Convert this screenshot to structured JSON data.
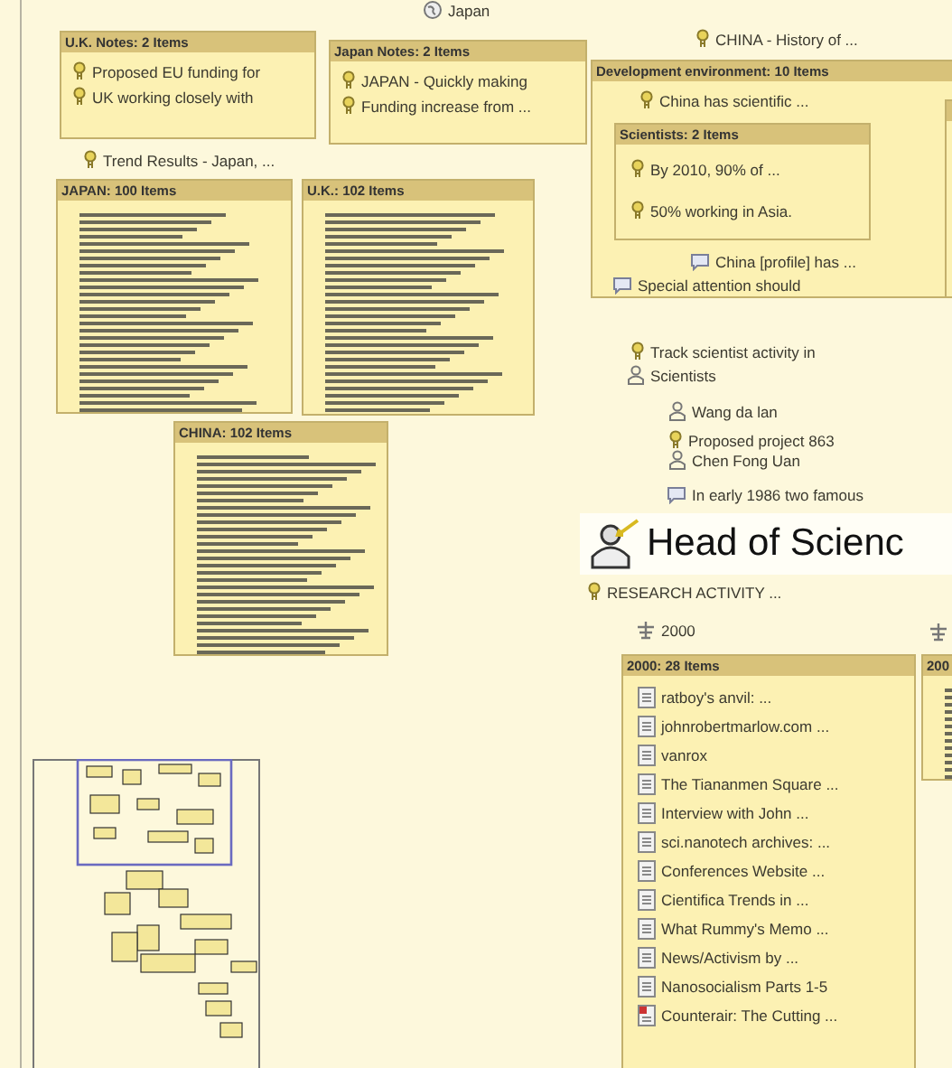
{
  "labels": [
    {
      "kind": "topic",
      "text": "Japan"
    },
    {
      "kind": "note",
      "text": "CHINA - History of ..."
    },
    {
      "kind": "note",
      "text": "Trend Results - Japan, ..."
    },
    {
      "kind": "note",
      "text": "Track scientist activity in"
    },
    {
      "kind": "person",
      "text": "Scientists"
    },
    {
      "kind": "person",
      "text": "Wang da lan"
    },
    {
      "kind": "note",
      "text": "Proposed project 863"
    },
    {
      "kind": "person",
      "text": "Chen Fong Uan"
    },
    {
      "kind": "comment",
      "text": "In early 1986 two famous"
    },
    {
      "kind": "note",
      "text": "RESEARCH ACTIVITY ..."
    },
    {
      "kind": "year",
      "text": "2000"
    }
  ],
  "focus": {
    "kind": "person",
    "text": "Head of Scienc"
  },
  "boxes": [
    {
      "kind": "list",
      "title": "U.K. Notes: 2 Items",
      "items": [
        {
          "kind": "note",
          "text": "Proposed EU funding for"
        },
        {
          "kind": "note",
          "text": "UK working closely with"
        }
      ]
    },
    {
      "kind": "list",
      "title": "Japan Notes: 2 Items",
      "items": [
        {
          "kind": "note",
          "text": "JAPAN - Quickly making"
        },
        {
          "kind": "note",
          "text": "Funding increase from ..."
        }
      ]
    },
    {
      "kind": "dense",
      "title": "JAPAN: 100 Items"
    },
    {
      "kind": "dense",
      "title": "U.K.: 102 Items"
    },
    {
      "kind": "dense",
      "title": "CHINA: 102 Items"
    },
    {
      "kind": "list",
      "title": "Development environment: 10 Items",
      "items": [
        {
          "kind": "note",
          "text": "China has scientific ..."
        },
        {
          "kind": "box",
          "title": "Scientists: 2 Items",
          "items": [
            {
              "kind": "note",
              "text": "By 2010, 90% of ..."
            },
            {
              "kind": "note",
              "text": "50% working in Asia."
            }
          ]
        },
        {
          "kind": "comment",
          "text": "China [profile] has ..."
        },
        {
          "kind": "comment",
          "text": "Special attention should"
        }
      ]
    },
    {
      "kind": "list",
      "title": "2000: 28 Items",
      "items": [
        {
          "kind": "document",
          "text": "ratboy's anvil: ..."
        },
        {
          "kind": "document",
          "text": "johnrobertmarlow.com ..."
        },
        {
          "kind": "document",
          "text": "vanrox"
        },
        {
          "kind": "document",
          "text": "The Tiananmen Square ..."
        },
        {
          "kind": "document",
          "text": "Interview with John ..."
        },
        {
          "kind": "document",
          "text": "sci.nanotech archives: ..."
        },
        {
          "kind": "document",
          "text": "Conferences Website ..."
        },
        {
          "kind": "document",
          "text": "Cientifica Trends in ..."
        },
        {
          "kind": "document",
          "text": "What Rummy's Memo ..."
        },
        {
          "kind": "document",
          "text": "News/Activism by ..."
        },
        {
          "kind": "document",
          "text": "Nanosocialism Parts 1-5"
        },
        {
          "kind": "link",
          "text": "Counterair: The Cutting ..."
        }
      ]
    },
    {
      "kind": "dense",
      "title": "200"
    }
  ]
}
